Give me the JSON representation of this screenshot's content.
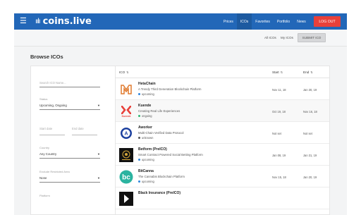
{
  "header": {
    "brand": "coins.live",
    "nav": [
      "Prices",
      "ICOs",
      "Favorites",
      "Portfolio",
      "News"
    ],
    "active_nav": "ICOs",
    "logout": "LOG OUT"
  },
  "subnav": {
    "all_icos": "All ICOs",
    "my_icos": "My ICOs",
    "submit": "SUBMIT ICO"
  },
  "page": {
    "title": "Browse ICOs"
  },
  "filters": {
    "search_placeholder": "Search ICO Name...",
    "status_label": "Status",
    "status_value": "Upcoming, Ongoing",
    "start_date_placeholder": "Start date",
    "end_date_placeholder": "End date",
    "country_label": "Country",
    "country_value": "Any Country",
    "exclude_label": "Exclude Restricted Area",
    "exclude_value": "None",
    "platform_label": "Platform"
  },
  "table": {
    "columns": {
      "ico": "ICO",
      "start": "Start",
      "end": "End"
    },
    "rows": [
      {
        "name": "HetaChain",
        "desc": "A Trendy Third Generation Blockchain Platform",
        "status": "upcoming",
        "start": "Nov 11, 18",
        "end": "Jan 30, 19",
        "logo": "hetachain-logo"
      },
      {
        "name": "Kuende",
        "desc": "Creating Real Life Experiences",
        "status": "ongoing",
        "start": "Oct 19, 18",
        "end": "Nov 16, 18",
        "logo": "kuende-logo"
      },
      {
        "name": "Aworker",
        "desc": "Multi-Chain Verified Data Protocol",
        "status": "unknown",
        "start": "Not set",
        "end": "Not set",
        "logo": "aworker-logo"
      },
      {
        "name": "Betform (PreICO)",
        "desc": "Smart Contract Powered Social Betting Platform",
        "status": "upcoming",
        "start": "Jan 08, 19",
        "end": "Jan 31, 19",
        "logo": "betform-logo"
      },
      {
        "name": "BitCanna",
        "desc": "The Cannabis Blockchain Platform",
        "status": "upcoming",
        "start": "Nov 15, 18",
        "end": "Jan 20, 19",
        "logo": "bitcanna-logo"
      },
      {
        "name": "Black Insurance (PreICO)",
        "desc": "",
        "status": "",
        "start": "",
        "end": "",
        "logo": "black-insurance-logo"
      }
    ]
  },
  "colors": {
    "header": "#2267b8",
    "logout": "#e8403a",
    "upcoming": "#2e86de",
    "ongoing": "#2eb872",
    "unknown": "#555555"
  }
}
